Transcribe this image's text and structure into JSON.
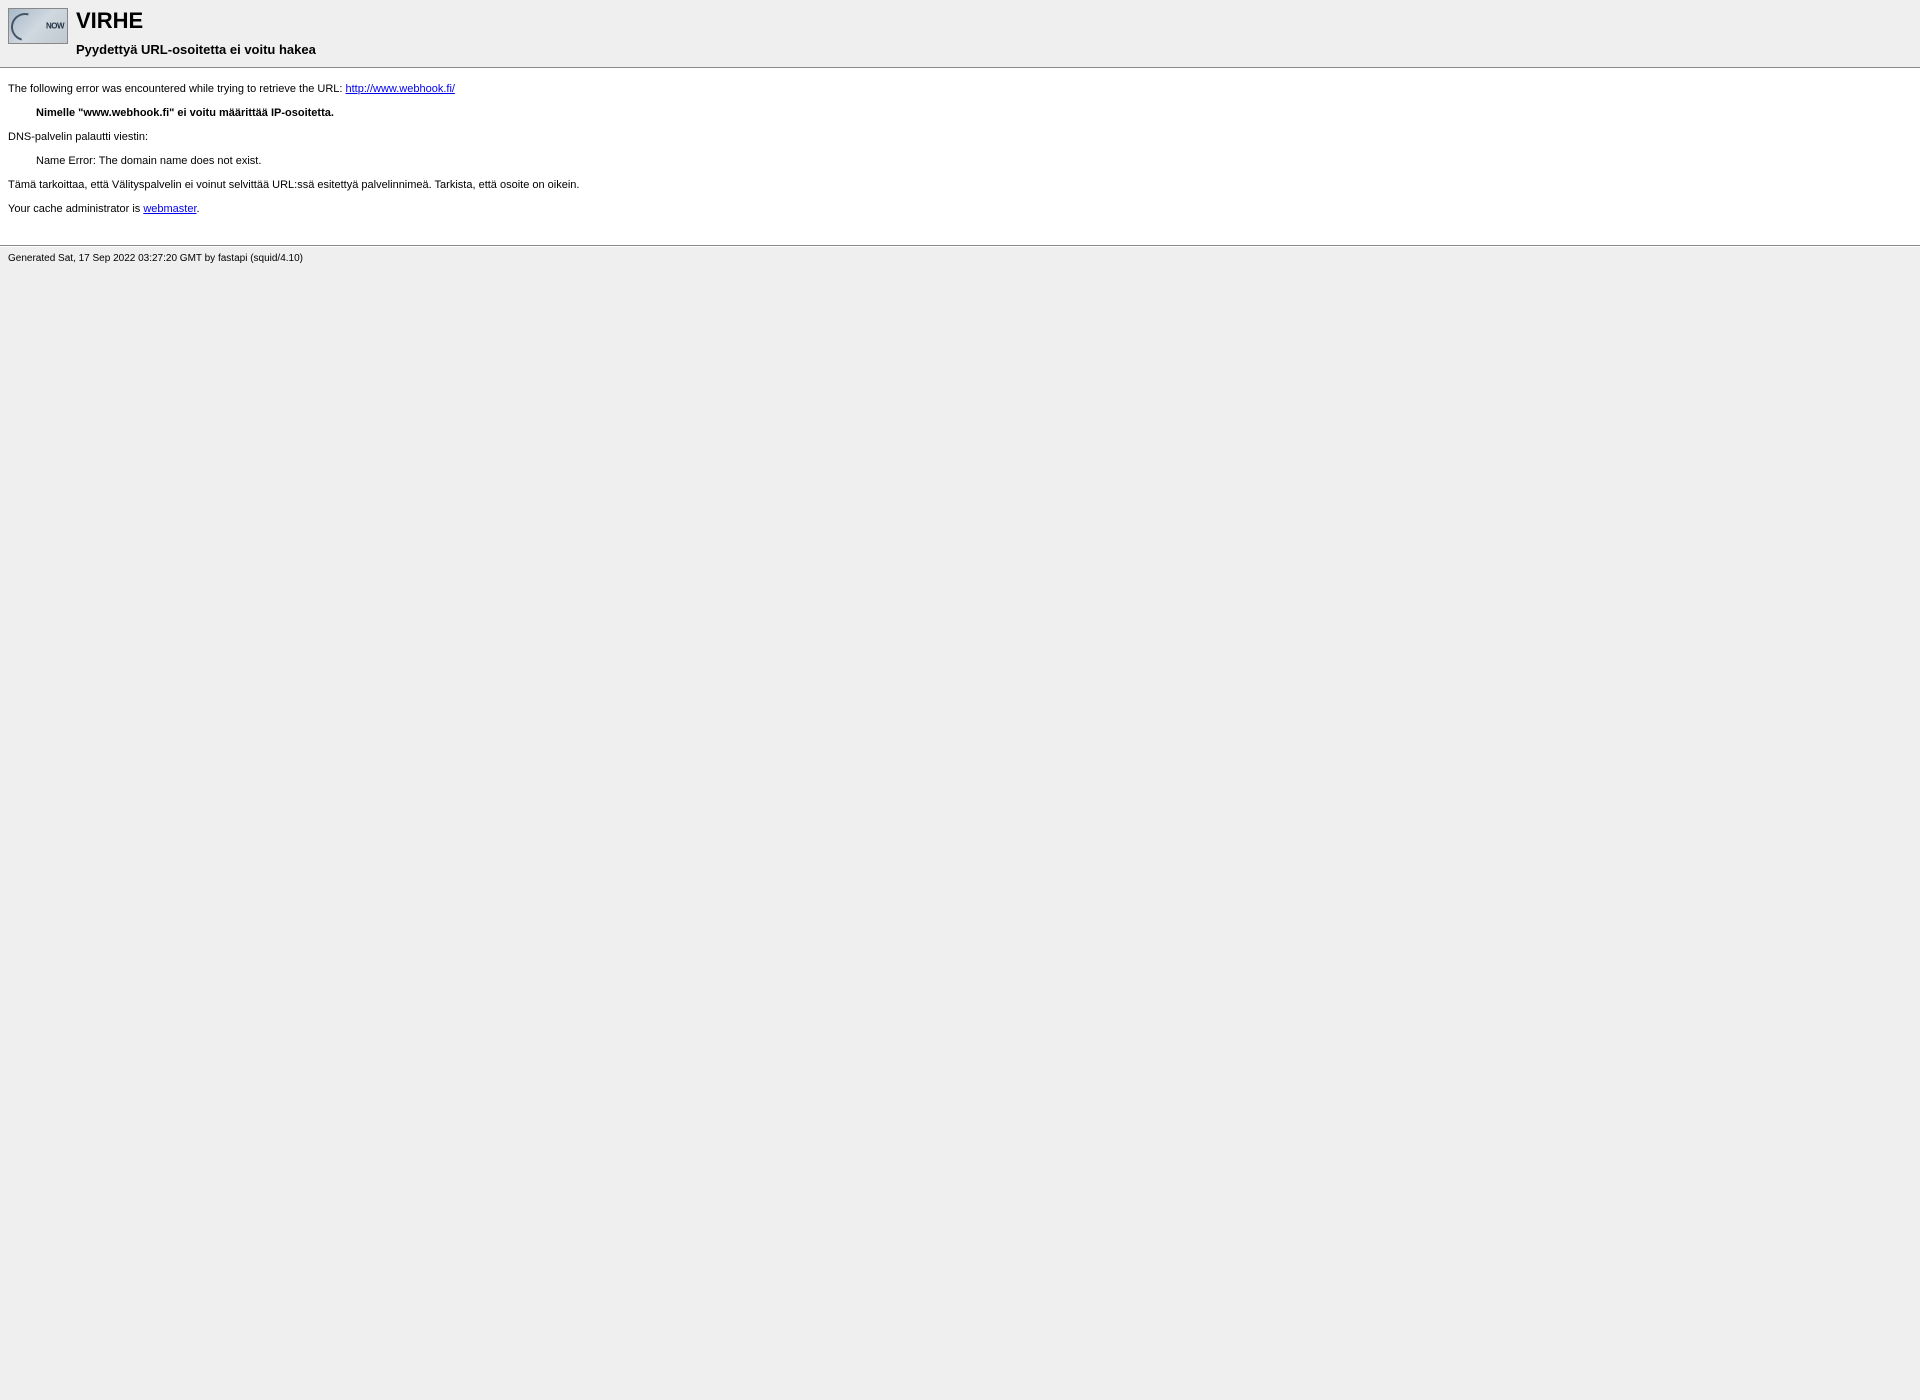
{
  "header": {
    "title": "VIRHE",
    "subtitle": "Pyydettyä URL-osoitetta ei voitu hakea",
    "icon_label": "NOW"
  },
  "body": {
    "error_intro": "The following error was encountered while trying to retrieve the URL: ",
    "url": "http://www.webhook.fi/",
    "dns_error": "Nimelle \"www.webhook.fi\" ei voitu määrittää IP-osoitetta.",
    "dns_returned": "DNS-palvelin palautti viestin:",
    "name_error": "Name Error: The domain name does not exist.",
    "explanation": "Tämä tarkoittaa, että Välityspalvelin ei voinut selvittää URL:ssä esitettyä palvelinnimeä. Tarkista, että osoite on oikein.",
    "admin_intro": "Your cache administrator is ",
    "admin_link": "webmaster",
    "admin_suffix": "."
  },
  "footer": {
    "generated": "Generated Sat, 17 Sep 2022 03:27:20 GMT by fastapi (squid/4.10)"
  }
}
